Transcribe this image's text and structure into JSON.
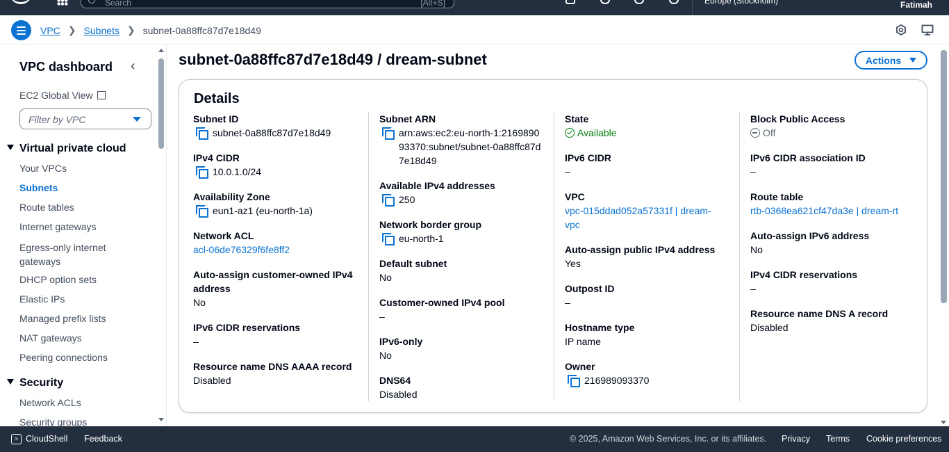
{
  "topnav": {
    "search_placeholder": "Search",
    "search_shortcut": "[Alt+S]",
    "region": "Europe (Stockholm)",
    "user": "Fatimah"
  },
  "breadcrumb": {
    "items": [
      "VPC",
      "Subnets"
    ],
    "current": "subnet-0a88ffc87d7e18d49"
  },
  "sidebar": {
    "title": "VPC dashboard",
    "global_view": "EC2 Global View",
    "filter_placeholder": "Filter by VPC",
    "sections": [
      {
        "title": "Virtual private cloud",
        "items": [
          "Your VPCs",
          "Subnets",
          "Route tables",
          "Internet gateways",
          "Egress-only internet gateways",
          "DHCP option sets",
          "Elastic IPs",
          "Managed prefix lists",
          "NAT gateways",
          "Peering connections"
        ]
      },
      {
        "title": "Security",
        "items": [
          "Network ACLs",
          "Security groups"
        ]
      }
    ],
    "active_item": "Subnets"
  },
  "main": {
    "title": "subnet-0a88ffc87d7e18d49 / dream-subnet",
    "actions_label": "Actions",
    "details_title": "Details",
    "columns": [
      [
        {
          "label": "Subnet ID",
          "value": "subnet-0a88ffc87d7e18d49",
          "copy": true
        },
        {
          "label": "IPv4 CIDR",
          "value": "10.0.1.0/24",
          "copy": true
        },
        {
          "label": "Availability Zone",
          "value": "eun1-az1 (eu-north-1a)",
          "copy": true
        },
        {
          "label": "Network ACL",
          "value": "acl-06de76329f6fe8ff2",
          "link": true
        },
        {
          "label": "Auto-assign customer-owned IPv4 address",
          "value": "No"
        },
        {
          "label": "IPv6 CIDR reservations",
          "value": "–"
        },
        {
          "label": "Resource name DNS AAAA record",
          "value": "Disabled"
        }
      ],
      [
        {
          "label": "Subnet ARN",
          "value": "arn:aws:ec2:eu-north-1:216989093370:subnet/subnet-0a88ffc87d7e18d49",
          "copy": true
        },
        {
          "label": "Available IPv4 addresses",
          "value": "250",
          "copy": true
        },
        {
          "label": "Network border group",
          "value": "eu-north-1",
          "copy": true
        },
        {
          "label": "Default subnet",
          "value": "No"
        },
        {
          "label": "Customer-owned IPv4 pool",
          "value": "–"
        },
        {
          "label": "IPv6-only",
          "value": "No"
        },
        {
          "label": "DNS64",
          "value": "Disabled"
        }
      ],
      [
        {
          "label": "State",
          "value": "Available",
          "status": "ok"
        },
        {
          "label": "IPv6 CIDR",
          "value": "–"
        },
        {
          "label": "VPC",
          "value": "vpc-015ddad052a57331f | dream-vpc",
          "link": true
        },
        {
          "label": "Auto-assign public IPv4 address",
          "value": "Yes"
        },
        {
          "label": "Outpost ID",
          "value": "–"
        },
        {
          "label": "Hostname type",
          "value": "IP name"
        },
        {
          "label": "Owner",
          "value": "216989093370",
          "copy": true
        }
      ],
      [
        {
          "label": "Block Public Access",
          "value": "Off",
          "status": "off"
        },
        {
          "label": "IPv6 CIDR association ID",
          "value": "–"
        },
        {
          "label": "Route table",
          "value": "rtb-0368ea621cf47da3e | dream-rt",
          "link": true
        },
        {
          "label": "Auto-assign IPv6 address",
          "value": "No"
        },
        {
          "label": "IPv4 CIDR reservations",
          "value": "–"
        },
        {
          "label": "Resource name DNS A record",
          "value": "Disabled"
        }
      ]
    ]
  },
  "footer": {
    "cloudshell": "CloudShell",
    "feedback": "Feedback",
    "copyright": "© 2025, Amazon Web Services, Inc. or its affiliates.",
    "privacy": "Privacy",
    "terms": "Terms",
    "cookie": "Cookie preferences"
  },
  "colors": {
    "nav_bg": "#232f3e",
    "link": "#0972d3",
    "success": "#037f0c",
    "text": "#000716"
  }
}
